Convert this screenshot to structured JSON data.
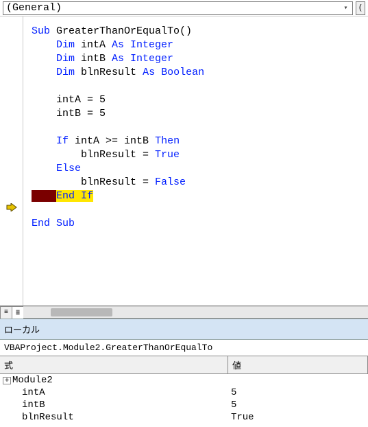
{
  "dropdown": {
    "scope": "(General)"
  },
  "code": {
    "sub_kw": "Sub",
    "sub_name": " GreaterThanOrEqualTo()",
    "dim_kw": "Dim",
    "as_int": "As Integer",
    "as_bool": "As Boolean",
    "var_a": " intA ",
    "var_b": " intB ",
    "var_r": " blnResult ",
    "assign_a": "intA = 5",
    "assign_b": "intB = 5",
    "if_kw": "If",
    "if_cond": " intA >= intB ",
    "then_kw": "Then",
    "res_true_lhs": "blnResult = ",
    "true_kw": "True",
    "else_kw": "Else",
    "res_false_lhs": "blnResult = ",
    "false_kw": "False",
    "endif_pad": "    ",
    "endif_kw": "End If",
    "endsub_kw": "End Sub"
  },
  "locals": {
    "title": "ローカル",
    "context": "VBAProject.Module2.GreaterThanOrEqualTo",
    "head_expr": "式",
    "head_val": "値",
    "rows": [
      {
        "name": "Module2",
        "value": "",
        "expand": true,
        "indent": 0
      },
      {
        "name": "intA",
        "value": "5",
        "expand": false,
        "indent": 1
      },
      {
        "name": "intB",
        "value": "5",
        "expand": false,
        "indent": 1
      },
      {
        "name": "blnResult",
        "value": "True",
        "expand": false,
        "indent": 1
      }
    ]
  }
}
